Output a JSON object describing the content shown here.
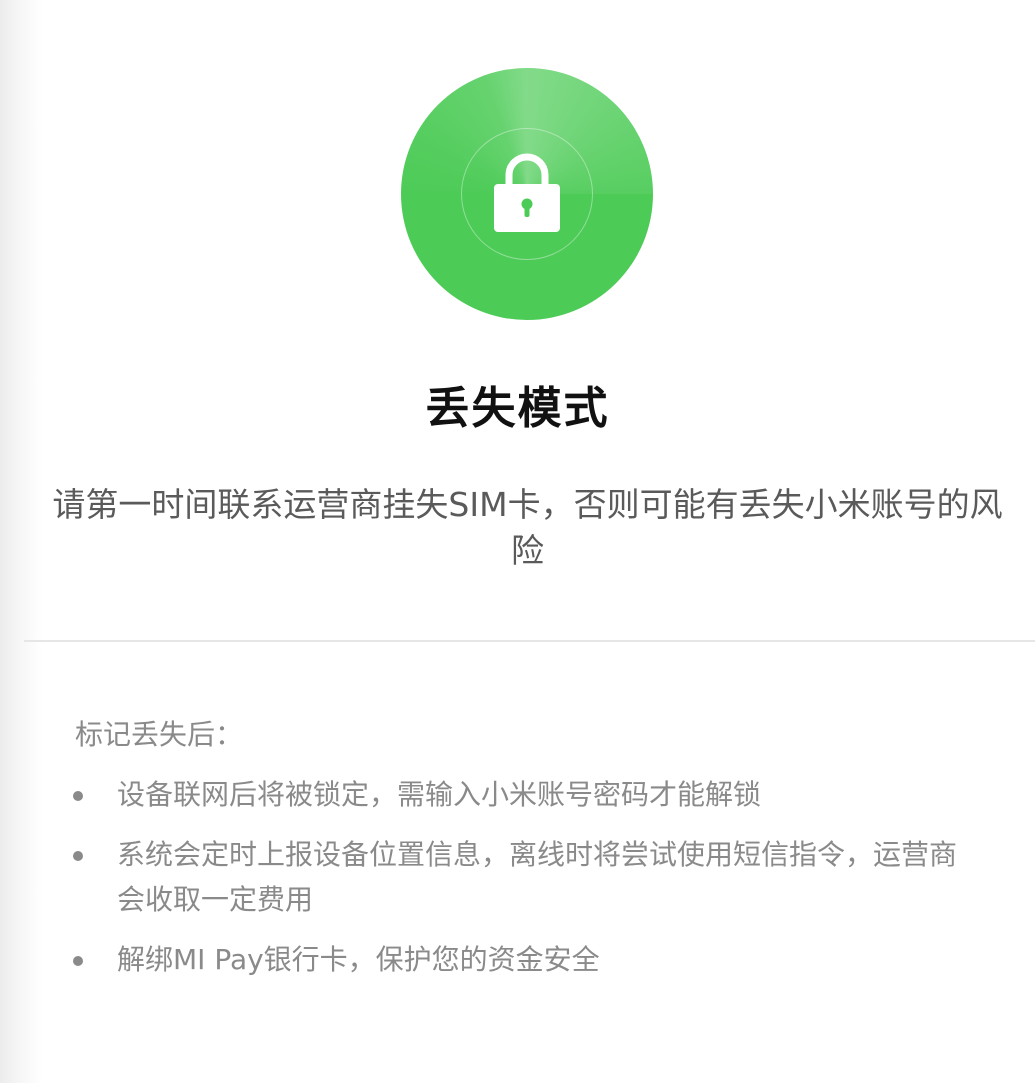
{
  "header": {
    "title": "丢失模式",
    "subtitle": "请第一时间联系运营商挂失SIM卡，否则可能有丢失小米账号的风险"
  },
  "badge": {
    "icon": "lock-icon",
    "color": "#4dcb57"
  },
  "details": {
    "heading": "标记丢失后：",
    "items": [
      {
        "text": "设备联网后将被锁定，需输入小米账号密码才能解锁"
      },
      {
        "text": "系统会定时上报设备位置信息，离线时将尝试使用短信指令，运营商会收取一定费用"
      },
      {
        "text": "解绑MI Pay银行卡，保护您的资金安全"
      }
    ]
  }
}
